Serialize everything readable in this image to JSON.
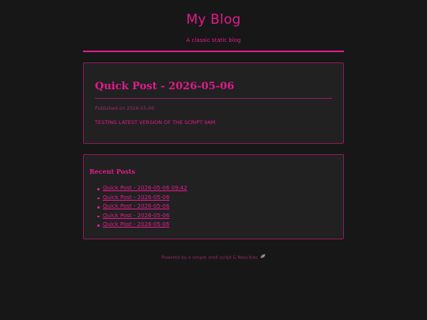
{
  "header": {
    "title": "My Blog",
    "tagline": "A classic static blog"
  },
  "post": {
    "title": "Quick Post - 2026-05-06",
    "meta": "Published on 2026-05-06",
    "body": "TESTING LATEST VERSION OF THE SCRIPT 9AM"
  },
  "recent": {
    "heading": "Recent Posts",
    "items": [
      {
        "label": "Quick Post - 2026-05-06 09:42"
      },
      {
        "label": "Quick Post - 2026-05-06"
      },
      {
        "label": "Quick Post - 2026-05-06"
      },
      {
        "label": "Quick Post - 2026-05-06"
      },
      {
        "label": "Quick Post - 2026-05-06"
      }
    ]
  },
  "footer": {
    "text": "Powered by a simple shell script & Neocities",
    "icon": "neocities-leaf-icon"
  },
  "colors": {
    "background": "#171717",
    "card": "#212121",
    "accent": "#e01c8c",
    "border": "#8d1b5a",
    "muted": "#9b2a68"
  }
}
